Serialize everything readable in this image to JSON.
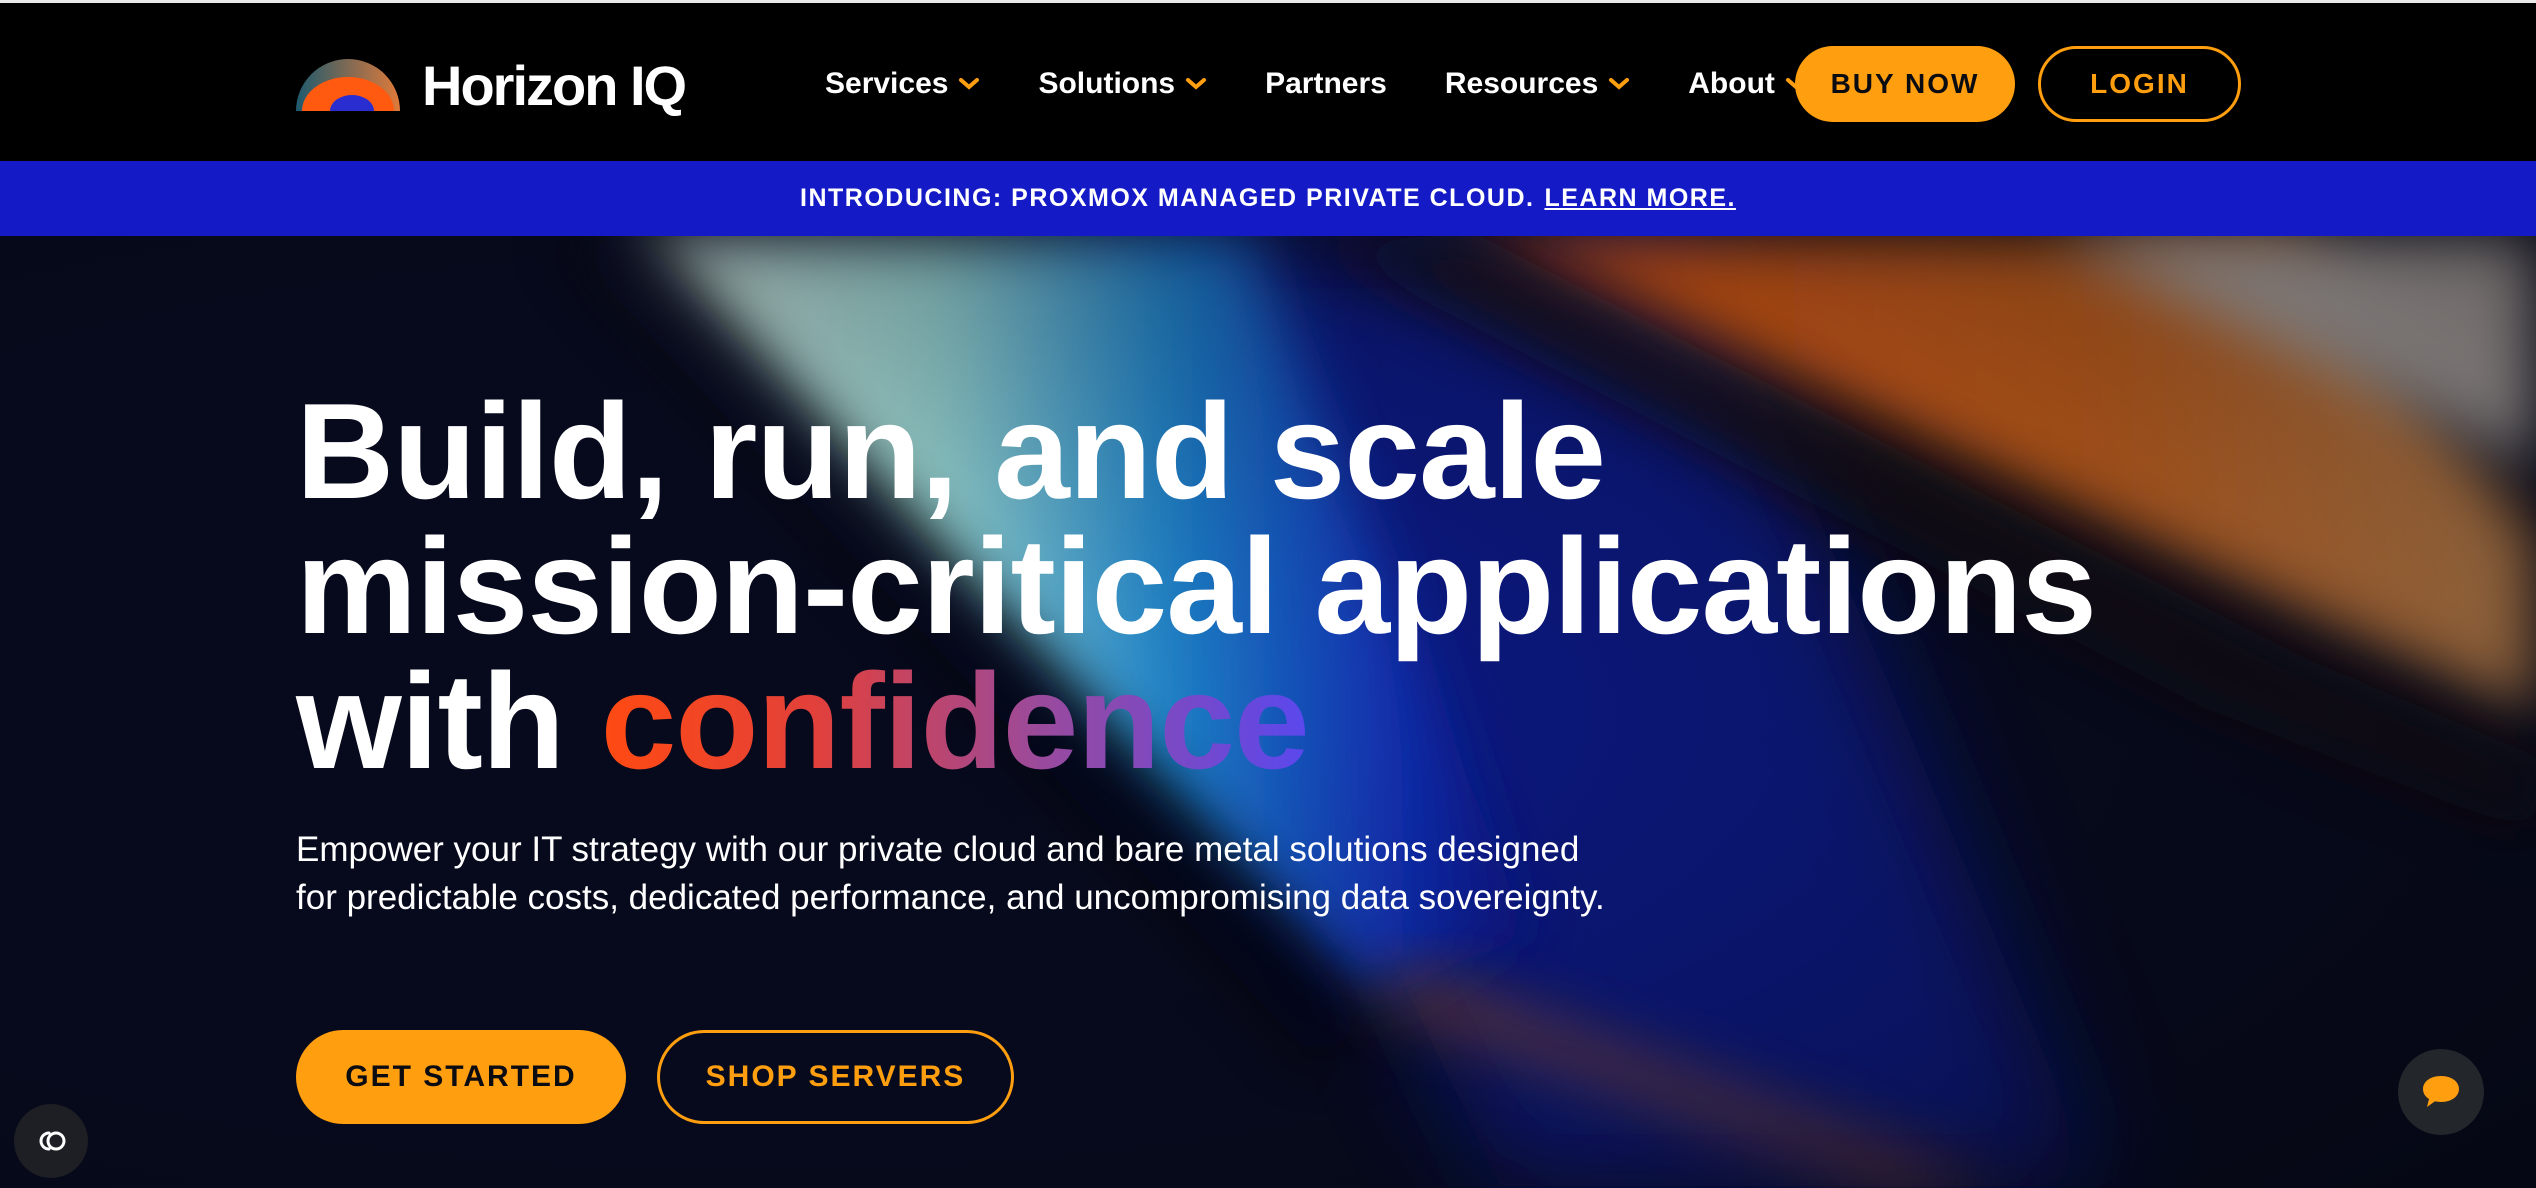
{
  "brand": {
    "name": "Horizon IQ"
  },
  "nav": {
    "items": [
      {
        "label": "Services",
        "has_dropdown": true
      },
      {
        "label": "Solutions",
        "has_dropdown": true
      },
      {
        "label": "Partners",
        "has_dropdown": false
      },
      {
        "label": "Resources",
        "has_dropdown": true
      },
      {
        "label": "About",
        "has_dropdown": true
      }
    ],
    "buy_label": "BUY NOW",
    "login_label": "LOGIN"
  },
  "announcement": {
    "text": "INTRODUCING: PROXMOX MANAGED PRIVATE CLOUD.",
    "link_label": "LEARN MORE."
  },
  "hero": {
    "headline_line1": "Build, run, and scale",
    "headline_line2": "mission-critical applications",
    "headline_line3_prefix": "with ",
    "headline_highlight": "confidence",
    "subtext": "Empower your IT strategy with our private cloud and bare metal solutions designed for predictable costs, dedicated performance, and uncompromising data sovereignty.",
    "primary_cta": "GET STARTED",
    "secondary_cta": "SHOP SERVERS"
  },
  "widgets": {
    "cookie_icon": "cookie-settings-icon",
    "chat_icon": "chat-bubble-icon"
  },
  "colors": {
    "accent": "#ff9e0f",
    "announcement_bg": "#131ac6",
    "nav_bg": "#000000",
    "hero_bg": "#070a1c",
    "highlight_gradient": [
      "#ff4a12",
      "#9a4a9c",
      "#5a48ee"
    ]
  }
}
